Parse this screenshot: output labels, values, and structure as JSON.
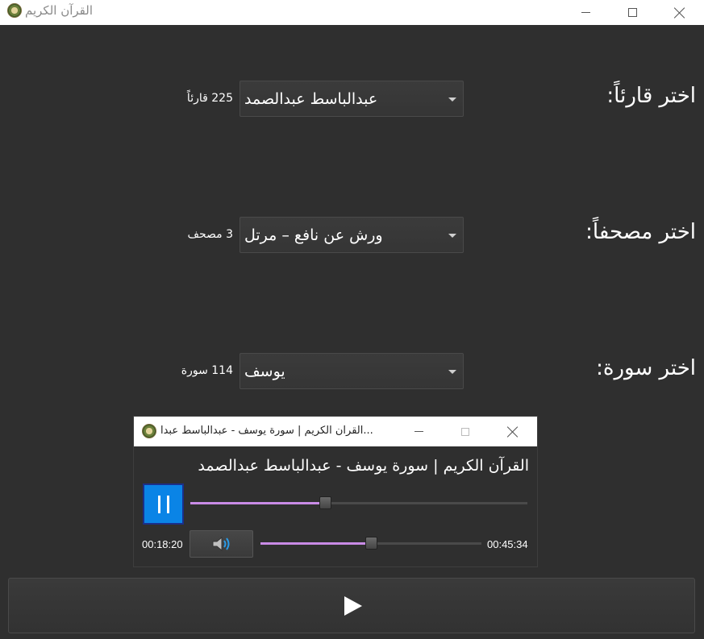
{
  "window": {
    "title": "القرآن الكريم"
  },
  "reciter": {
    "label": "اختر قارئاً:",
    "selected": "عبدالباسط عبدالصمد",
    "count": "225 قارئاً"
  },
  "mushaf": {
    "label": "اختر مصحفاً:",
    "selected": "ورش عن نافع – مرتل",
    "count": "3 مصحف"
  },
  "surah": {
    "label": "اختر سورة:",
    "selected": "يوسف",
    "count": "114 سورة"
  },
  "player": {
    "window_title": "...القرآن الكريم | سورة يوسف - عبدالباسط عبدا",
    "now_playing": "القرآن الكريم | سورة يوسف - عبدالباسط عبدالصمد",
    "elapsed": "00:18:20",
    "total": "00:45:34",
    "progress": 0.4,
    "volume": 0.5
  },
  "icons": {
    "app": "quran-logo-icon",
    "pause": "pause-icon",
    "volume": "speaker-icon",
    "play": "play-icon"
  },
  "colors": {
    "background": "#2f2f2f",
    "accent_button": "#0a84e6",
    "slider_fill": "#c98be6"
  }
}
